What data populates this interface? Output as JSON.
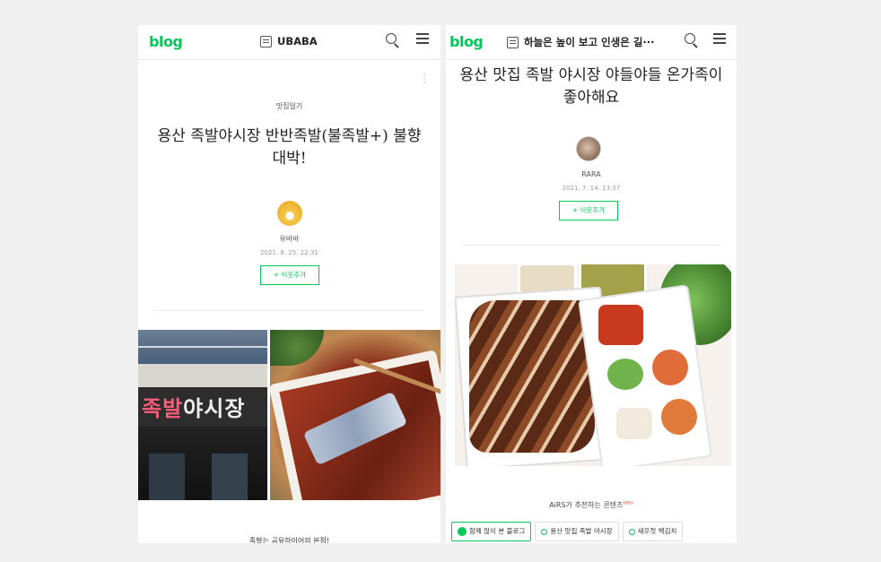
{
  "left": {
    "brand": "blog",
    "blog_name": "UBABA",
    "category": "맛집일기",
    "title": "용산 족발야시장 반반족발(불족발+) 불향 대박!",
    "author": "유바바",
    "date": "2021. 8. 25. 22:31",
    "follow_label": "+ 이웃추가",
    "sign_text_red": "족발",
    "sign_text_white": "야시장",
    "bottom_text": "족발는 공유하이어의 본점!"
  },
  "right": {
    "brand": "blog",
    "blog_name": "하늘은 높이 보고 인생은 길···",
    "title": "용산 맛집 족발 야시장 야들야들 온가족이 좋아해요",
    "author": "RARA",
    "date": "2021. 7. 14. 13:37",
    "follow_label": "+ 이웃추가",
    "airs_label": "AiRS가 추천하는 콘텐츠",
    "airs_badge": "beta",
    "chips": [
      "함께 많이 본 블로그",
      "용산 맛집 족발 야시장",
      "새우젓 백김치"
    ]
  },
  "colors": {
    "brand_green": "#03c75a",
    "background": "#f0f0f0"
  }
}
